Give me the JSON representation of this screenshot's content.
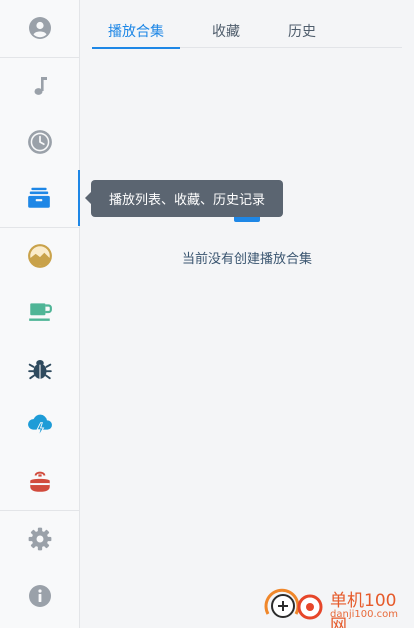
{
  "tabs": [
    {
      "label": "播放合集"
    },
    {
      "label": "收藏"
    },
    {
      "label": "历史"
    }
  ],
  "empty_state": {
    "message": "当前没有创建播放合集"
  },
  "tooltip": {
    "text": "播放列表、收藏、历史记录"
  },
  "watermark": {
    "title": "单机100网",
    "url": "danji100.com"
  },
  "sidebar_icons": [
    "user-icon",
    "music-note-icon",
    "clock-icon",
    "archive-box-icon",
    "landscape-icon",
    "coffee-cup-icon",
    "bug-icon",
    "cloud-lightning-icon",
    "teapot-icon",
    "gear-icon",
    "info-icon"
  ],
  "colors": {
    "accent": "#1e87e6",
    "icon_gray": "#9aa1a9",
    "tooltip_bg": "#5b6571",
    "landscape": "#c9a24a",
    "coffee": "#4fb596",
    "bug": "#2e4a5e",
    "cloud": "#1e9cd7",
    "teapot": "#d14b3c"
  }
}
